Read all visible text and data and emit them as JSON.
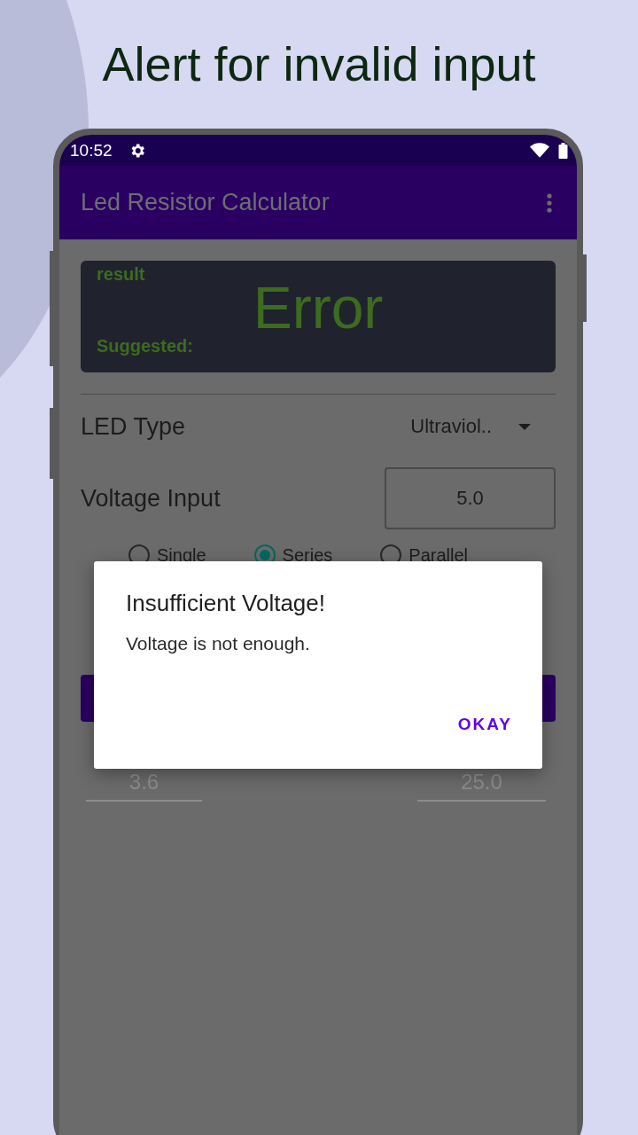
{
  "headline": "Alert for invalid input",
  "status_bar": {
    "time": "10:52"
  },
  "app_bar": {
    "title": "Led Resistor Calculator"
  },
  "result_card": {
    "label": "result",
    "value": "Error",
    "suggested_label": "Suggested:"
  },
  "led_type": {
    "label": "LED Type",
    "value": "Ultraviol.."
  },
  "voltage_input": {
    "label": "Voltage Input",
    "value": "5.0"
  },
  "connection": [
    {
      "label": "Single",
      "selected": false
    },
    {
      "label": "Series",
      "selected": true
    },
    {
      "label": "Parallel",
      "selected": false
    }
  ],
  "fields": [
    {
      "placeholder": "3.6"
    },
    {
      "placeholder": "25.0"
    }
  ],
  "dialog": {
    "title": "Insufficient Voltage!",
    "message": "Voltage is not enough.",
    "button": "OKAY"
  }
}
